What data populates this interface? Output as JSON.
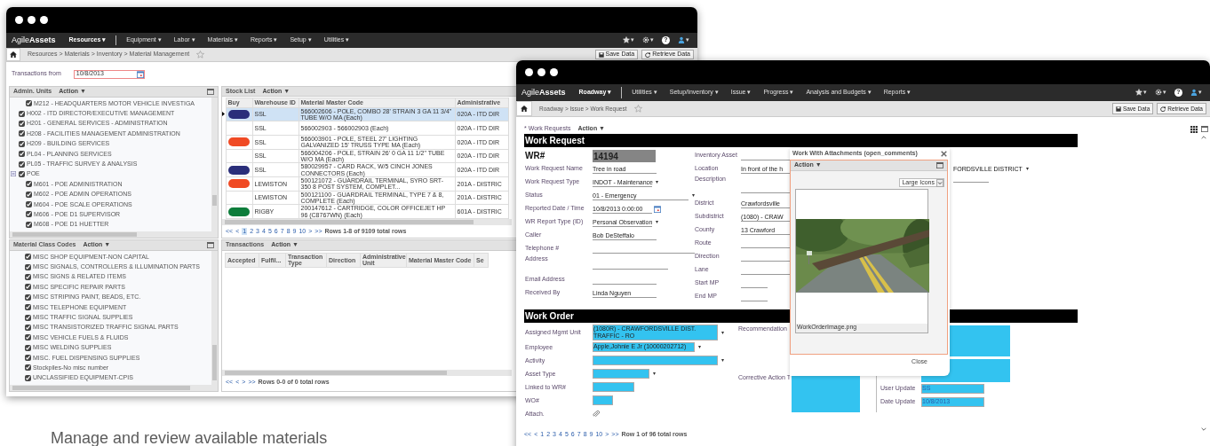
{
  "left_window": {
    "logo": "Agile**Assets**",
    "nav_menu": [
      {
        "label": "Resources ▾",
        "selected": true
      },
      {
        "label": "Equipment ▾",
        "selected": false
      },
      {
        "label": "Labor ▾",
        "selected": false
      },
      {
        "label": "Materials ▾",
        "selected": false
      },
      {
        "label": "Reports ▾",
        "selected": false
      },
      {
        "label": "Setup ▾",
        "selected": false
      },
      {
        "label": "Utilities ▾",
        "selected": false
      }
    ],
    "toolbar": [
      {
        "kind": "star",
        "caret": "▾"
      },
      {
        "kind": "gear",
        "caret": "▾"
      },
      {
        "kind": "help",
        "glyph": "?"
      },
      {
        "kind": "user",
        "caret": "▾"
      }
    ],
    "breadcrumb": "Resources > Materials > Inventory > Material Management",
    "buttons": [
      {
        "kind": "save",
        "label": "Save Data"
      },
      {
        "kind": "retrieve",
        "label": "Retrieve Data"
      }
    ],
    "transactions_from": {
      "label": "Transactions from",
      "value": "10/8/2013"
    },
    "admin_units": {
      "title": "Admin. Units",
      "action": "Action ▼",
      "continued_children": [
        {
          "label": "M212 - HEADQUARTERS MOTOR VEHICLE INVESTIGA",
          "checked": true
        }
      ],
      "items": [
        {
          "label": "H002 - ITD DIRECTOR/EXECUTIVE MANAGEMENT",
          "checked": true
        },
        {
          "label": "H201 - GENERAL SERVICES - ADMINISTRATION",
          "checked": true
        },
        {
          "label": "H208 - FACILITIES MANAGEMENT ADMINISTRATION",
          "checked": true
        },
        {
          "label": "H209 - BUILDING SERVICES",
          "checked": true
        },
        {
          "label": "PL04 - PLANNING SERVICES",
          "checked": true
        },
        {
          "label": "PL05 - TRAFFIC SURVEY & ANALYSIS",
          "checked": true
        },
        {
          "label": "POE",
          "checked": true,
          "expanded": true,
          "children": [
            {
              "label": "M601 - POE ADMINISTRATION",
              "checked": true
            },
            {
              "label": "M602 - POE ADMIN OPERATIONS",
              "checked": true
            },
            {
              "label": "M604 - POE SCALE OPERATIONS",
              "checked": true
            },
            {
              "label": "M606 - POE D1 SUPERVISOR",
              "checked": true
            },
            {
              "label": "M608 - POE D1 HUETTER",
              "checked": true
            }
          ]
        }
      ]
    },
    "stock_list": {
      "title": "Stock List",
      "action": "Action ▼",
      "columns": [
        "Buy",
        "Warehouse ID",
        "Material Master Code",
        "Administrative"
      ],
      "rows": [
        {
          "selected": true,
          "color": "#2a2e7a",
          "cells": [
            "",
            "SSL",
            "566002606 - POLE, COMBO 28' STRAIN 3 GA 11 3/4\" TUBE W/O MA (Each)",
            "020A - ITD DIR"
          ]
        },
        {
          "selected": false,
          "cells": [
            "",
            "SSL",
            "566002903 - 566002903 (Each)",
            "020A - ITD DIR"
          ]
        },
        {
          "selected": false,
          "color": "#f04a24",
          "cells": [
            "",
            "SSL",
            "566003901 - POLE, STEEL 27' LIGHTING GALVANIZED 15' TRUSS TYPE MA (Each)",
            "020A - ITD DIR"
          ]
        },
        {
          "selected": false,
          "cells": [
            "",
            "SSL",
            "566004206 - POLE, STRAIN 26' 0 GA 11 1/2\" TUBE W/O MA (Each)",
            "020A - ITD DIR"
          ]
        },
        {
          "selected": false,
          "color": "#2a2e7a",
          "cells": [
            "",
            "SSL",
            "580029957 - CARD RACK, W/5 CINCH JONES CONNECTORS (Each)",
            "020A - ITD DIR"
          ]
        },
        {
          "selected": false,
          "color": "#f04a24",
          "cells": [
            "",
            "LEWISTON",
            "500121072 - GUARDRAIL TERMINAL, SYRO SRT-350 8 POST SYSTEM, COMPLET...",
            "201A - DISTRIC"
          ]
        },
        {
          "selected": false,
          "cells": [
            "",
            "LEWISTON",
            "500121100 - GUARDRAIL TERMINAL, TYPE 7 & 8, COMPLETE (Each)",
            "201A - DISTRIC"
          ]
        },
        {
          "selected": false,
          "color": "#0d7d3b",
          "cells": [
            "",
            "RIGBY",
            "200147612 - CARTRIDGE, COLOR OFFICEJET HP 96 (C8767WN) (Each)",
            "601A - DISTRIC"
          ]
        }
      ],
      "pager": {
        "first": "<<",
        "prev": "<",
        "pages": [
          {
            "label": "1",
            "selected": true
          },
          {
            "label": "2",
            "selected": false
          },
          {
            "label": "3",
            "selected": false
          },
          {
            "label": "4",
            "selected": false
          },
          {
            "label": "5",
            "selected": false
          },
          {
            "label": "6",
            "selected": false
          },
          {
            "label": "7",
            "selected": false
          },
          {
            "label": "8",
            "selected": false
          },
          {
            "label": "9",
            "selected": false
          },
          {
            "label": "10",
            "selected": false
          }
        ],
        "next": ">",
        "last": ">>",
        "summary": "Rows 1-8 of 9109 total rows"
      }
    },
    "material_class_codes": {
      "title": "Material Class Codes",
      "action": "Action ▼",
      "items": [
        {
          "label": "MISC SHOP EQUIPMENT-NON CAPITAL",
          "checked": true
        },
        {
          "label": "MISC SIGNALS, CONTROLLERS & ILLUMINATION PARTS",
          "checked": true
        },
        {
          "label": "MISC SIGNS & RELATED ITEMS",
          "checked": true
        },
        {
          "label": "MISC SPECIFIC REPAIR PARTS",
          "checked": true
        },
        {
          "label": "MISC STRIPING PAINT, BEADS, ETC.",
          "checked": true
        },
        {
          "label": "MISC TELEPHONE EQUIPMENT",
          "checked": true
        },
        {
          "label": "MISC TRAFFIC SIGNAL SUPPLIES",
          "checked": true
        },
        {
          "label": "MISC TRANSISTORIZED TRAFFIC SIGNAL PARTS",
          "checked": true
        },
        {
          "label": "MISC VEHICLE FUELS & FLUIDS",
          "checked": true
        },
        {
          "label": "MISC WELDING SUPPLIES",
          "checked": true
        },
        {
          "label": "MISC. FUEL DISPENSING SUPPLIES",
          "checked": true
        },
        {
          "label": "Stockpiles-No misc number",
          "checked": true
        },
        {
          "label": "UNCLASSIFIED EQUIPMENT-CPIS",
          "checked": true
        }
      ]
    },
    "transactions": {
      "title": "Transactions",
      "action": "Action ▼",
      "columns": [
        "Accepted",
        "Fulfil...",
        "Transaction Type",
        "Direction",
        "Administrative Unit",
        "Material Master Code",
        "Se"
      ],
      "pager": {
        "first": "<<",
        "prev": "<",
        "next": ">",
        "last": ">>",
        "summary": "Rows 0-0 of 0 total rows"
      }
    }
  },
  "right_window": {
    "logo": "Agile**Assets**",
    "nav_menu": [
      {
        "label": "Roadway ▾",
        "selected": true
      },
      {
        "label": "Utilities ▾",
        "selected": false
      },
      {
        "label": "Setup/Inventory ▾",
        "selected": false
      },
      {
        "label": "Issue ▾",
        "selected": false
      },
      {
        "label": "Progress ▾",
        "selected": false
      },
      {
        "label": "Analysis and Budgets ▾",
        "selected": false
      },
      {
        "label": "Reports ▾",
        "selected": false
      }
    ],
    "toolbar": [
      {
        "kind": "star",
        "caret": "▾"
      },
      {
        "kind": "gear",
        "caret": "▾"
      },
      {
        "kind": "help",
        "glyph": "?"
      },
      {
        "kind": "user",
        "caret": "▾"
      }
    ],
    "breadcrumb": "Roadway > Issue > Work Request",
    "buttons": [
      {
        "kind": "save",
        "label": "Save Data"
      },
      {
        "kind": "retrieve",
        "label": "Retrieve Data"
      }
    ],
    "list_header": {
      "title": "* Work Requests",
      "action": "Action ▼"
    },
    "work_request": {
      "title": "Work Request",
      "fields_left": [
        {
          "kind": "id",
          "label": "WR#",
          "value": "14194"
        },
        {
          "kind": "text",
          "label": "Work Request Name",
          "value": "Tree in road"
        },
        {
          "kind": "select",
          "label": "Work Request Type",
          "value": "INDOT - Maintenance",
          "caret": "▾"
        },
        {
          "kind": "wide_select",
          "label": "Status",
          "value": "01 - Emergency",
          "caret": "▾"
        },
        {
          "kind": "date",
          "label": "Reported Date / Time",
          "value": "10/8/2013 0:00:00"
        },
        {
          "kind": "select",
          "label": "WR Report Type (ID)",
          "value": "Personal Observation",
          "caret": "▾"
        },
        {
          "kind": "text",
          "label": "Caller",
          "value": "Bob DeSteffalo"
        },
        {
          "kind": "wide_text",
          "label": "Telephone #"
        },
        {
          "kind": "textarea",
          "label": "Address"
        },
        {
          "kind": "text",
          "label": "Email Address"
        },
        {
          "kind": "text",
          "label": "Received By",
          "value": "Linda Nguyen"
        }
      ],
      "fields_middle": [
        {
          "kind": "text",
          "label": "Inventory Asset"
        },
        {
          "kind": "text",
          "label": "Location",
          "value": "In front of the h"
        },
        {
          "kind": "textarea",
          "label": "Description"
        },
        {
          "kind": "text",
          "label": "District",
          "value": "Crawfordsville"
        },
        {
          "kind": "text",
          "label": "Subdistrict",
          "value": "(1080) - CRAW"
        },
        {
          "kind": "text",
          "label": "County",
          "value": "13 Crawford"
        },
        {
          "kind": "text",
          "label": "Route"
        },
        {
          "kind": "text",
          "label": "Direction"
        },
        {
          "kind": "text",
          "label": "Lane"
        },
        {
          "kind": "short_text",
          "label": "Start MP"
        },
        {
          "kind": "short_text",
          "label": "End MP"
        }
      ],
      "district_field": {
        "value": "FORDSVILLE DISTRICT",
        "caret": "▾"
      }
    },
    "work_order": {
      "title": "Work Order",
      "fields": [
        {
          "kind": "select",
          "label": "Assigned Mgmt Unit",
          "value": "(1080R) - CRAWFORDSVILLE DIST. TRAFFIC - RO",
          "caret": "▾",
          "highlighted": true
        },
        {
          "kind": "select",
          "label": "Employee",
          "value": "Apple,Johnie E Jr (10000202712)",
          "caret": "▾",
          "highlighted": true
        },
        {
          "kind": "select",
          "label": "Activity",
          "caret": "▾",
          "highlighted": true
        },
        {
          "kind": "select",
          "label": "Asset Type",
          "caret": "▾",
          "highlighted": true
        },
        {
          "kind": "text",
          "label": "Linked to WR#",
          "highlighted": true
        },
        {
          "kind": "text",
          "label": "WO#",
          "highlighted": true
        },
        {
          "kind": "attachment",
          "label": "Attach."
        }
      ],
      "recommendation": {
        "label": "Recommendation"
      },
      "corrective_action": {
        "label": "Corrective Action T"
      },
      "user_update": {
        "label": "User Update",
        "value": "SS"
      },
      "date_update": {
        "label": "Date Update",
        "value": "10/8/2013"
      }
    },
    "pager": {
      "first": "<<",
      "prev": "<",
      "pages": [
        {
          "label": "1",
          "selected": false
        },
        {
          "label": "2",
          "selected": false
        },
        {
          "label": "3",
          "selected": false
        },
        {
          "label": "4",
          "selected": false
        },
        {
          "label": "5",
          "selected": false
        },
        {
          "label": "6",
          "selected": false
        },
        {
          "label": "7",
          "selected": false
        },
        {
          "label": "8",
          "selected": false
        },
        {
          "label": "9",
          "selected": false
        },
        {
          "label": "10",
          "selected": false
        }
      ],
      "next": ">",
      "last": ">>",
      "summary": "Row 1 of 96 total rows"
    },
    "dialog": {
      "title": "Work With Attachments (open_comments)",
      "action": "Action ▼",
      "view_select": "Large Icons",
      "attachments": [
        {
          "kind": "picture",
          "name": "WorkOrderImage.png"
        }
      ],
      "close_button": "Close"
    }
  },
  "caption": "Manage and review available materials"
}
